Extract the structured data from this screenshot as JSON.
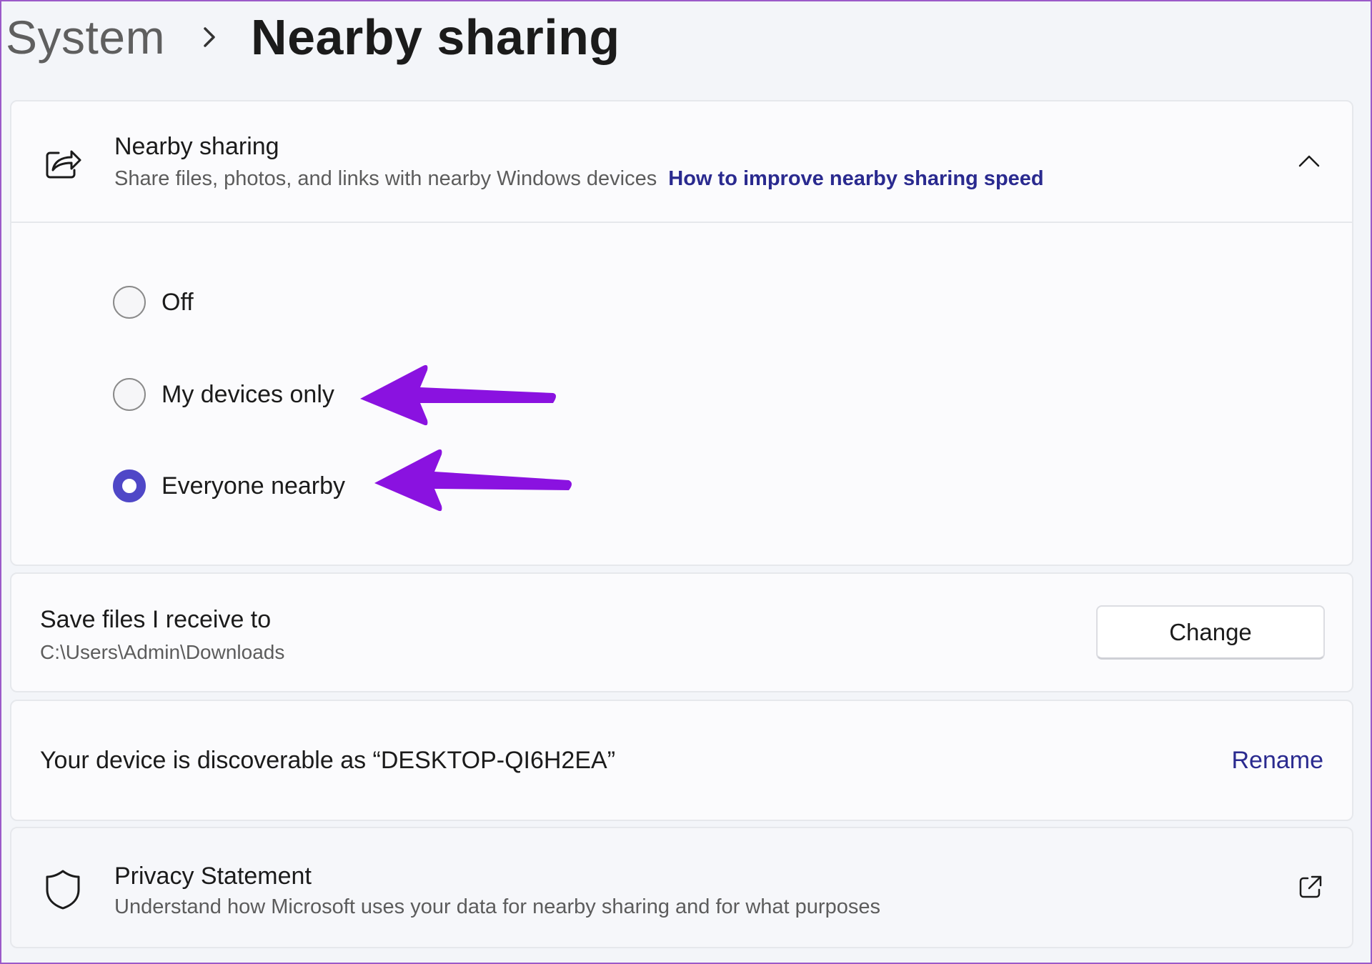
{
  "breadcrumb": {
    "parent": "System",
    "separator_icon": "chevron-right-icon",
    "current": "Nearby sharing"
  },
  "nearby_sharing": {
    "icon": "share-icon",
    "title": "Nearby sharing",
    "description": "Share files, photos, and links with nearby Windows devices",
    "link": "How to improve nearby sharing speed",
    "expand_icon": "chevron-up-icon",
    "options": [
      {
        "label": "Off",
        "selected": false
      },
      {
        "label": "My devices only",
        "selected": false
      },
      {
        "label": "Everyone nearby",
        "selected": true
      }
    ]
  },
  "save_files": {
    "title": "Save files I receive to",
    "path": "C:\\Users\\Admin\\Downloads",
    "button": "Change"
  },
  "discoverable": {
    "text": "Your device is discoverable as “DESKTOP-QI6H2EA”",
    "action": "Rename"
  },
  "privacy": {
    "icon": "shield-icon",
    "title": "Privacy Statement",
    "description": "Understand how Microsoft uses your data for nearby sharing and for what purposes",
    "link_icon": "external-link-icon"
  },
  "colors": {
    "accent": "#4f47c7",
    "link": "#2a2a8f",
    "annotation_arrow": "#8a12e0"
  }
}
